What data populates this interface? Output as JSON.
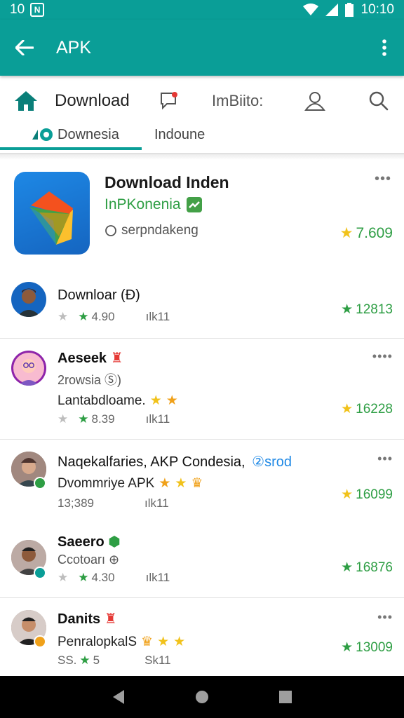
{
  "status_bar": {
    "time_left": "10",
    "badge": "N",
    "time_right": "10:10"
  },
  "app_bar": {
    "title": "APK"
  },
  "tabs_primary": [
    {
      "label": "Download",
      "icon": "home-icon"
    },
    {
      "label": "",
      "icon": "chat-icon"
    },
    {
      "label": "ImBiito:",
      "icon": ""
    },
    {
      "label": "",
      "icon": "profile-icon"
    },
    {
      "label": "",
      "icon": "search-icon"
    }
  ],
  "tabs_secondary": [
    {
      "label": "Downesia"
    },
    {
      "label": "Indoune"
    }
  ],
  "featured": {
    "title": "Download Inden",
    "subtitle": "InPKonenia",
    "meta": "serpndakeng",
    "rating": "7.609",
    "menu": "•••"
  },
  "rows": [
    {
      "title": "Downloar (Ð)",
      "line2": "",
      "line3": "",
      "stars_value": "4.90",
      "size": "ılk11",
      "rating": "12813",
      "menu": ""
    },
    {
      "title": "Aeseek",
      "line2": "2rowsia Ⓢ)",
      "line3": "Lantabdloame.",
      "stars_value": "8.39",
      "size": "ılk11",
      "rating": "16228",
      "menu": "••••"
    },
    {
      "title": "Naqekalfaries, AKP Condesia,",
      "title_extra": "②srod",
      "line2": "Dvommriye APK",
      "line3": "",
      "stars_value": "13;389",
      "size": "ılk11",
      "rating": "16099",
      "menu": "•••"
    },
    {
      "title": "Saeero",
      "line2": "Ccotoarı ⊕",
      "line3": "",
      "stars_value": "4.30",
      "size": "ılk11",
      "rating": "16876",
      "menu": ""
    },
    {
      "title": "Danits",
      "line2": "PenralopkalS",
      "line3": "",
      "stars_prefix": "SS.",
      "stars_value": "5",
      "size": "Sk11",
      "rating": "13009",
      "menu": "•••"
    }
  ],
  "colors": {
    "primary": "#0a9e97",
    "green": "#2e9e44",
    "gold": "#f1c21b"
  }
}
